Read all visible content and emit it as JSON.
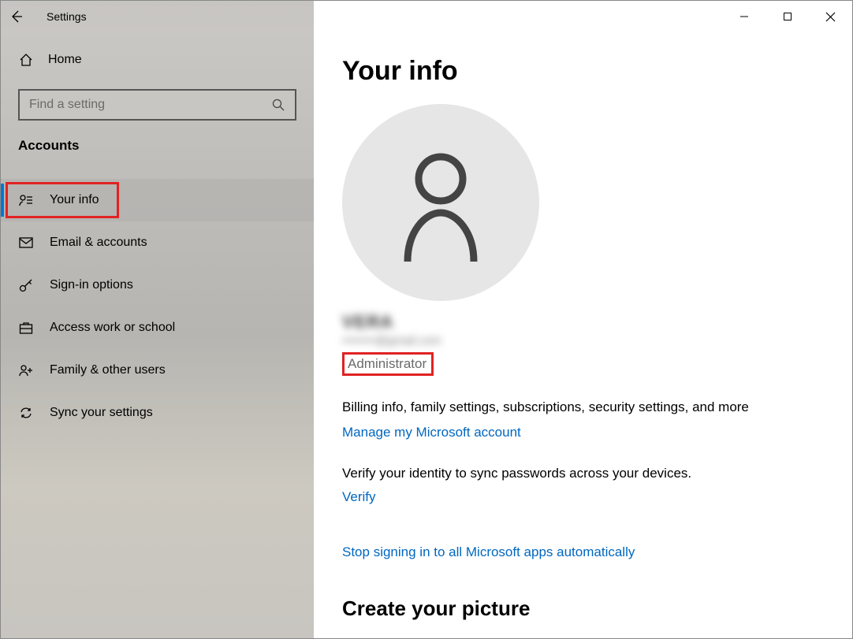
{
  "titlebar": {
    "app_title": "Settings"
  },
  "sidebar": {
    "home_label": "Home",
    "search_placeholder": "Find a setting",
    "section_header": "Accounts",
    "items": [
      {
        "label": "Your info",
        "selected": true
      },
      {
        "label": "Email & accounts"
      },
      {
        "label": "Sign-in options"
      },
      {
        "label": "Access work or school"
      },
      {
        "label": "Family & other users"
      },
      {
        "label": "Sync your settings"
      }
    ]
  },
  "main": {
    "page_title": "Your info",
    "user_name": "VERA",
    "user_email": "••••••••@gmail.com",
    "role": "Administrator",
    "desc_line": "Billing info, family settings, subscriptions, security settings, and more",
    "manage_link": "Manage my Microsoft account",
    "verify_desc": "Verify your identity to sync passwords across your devices.",
    "verify_link": "Verify",
    "stop_signin_link": "Stop signing in to all Microsoft apps automatically",
    "cutoff_heading": "Create your picture"
  }
}
